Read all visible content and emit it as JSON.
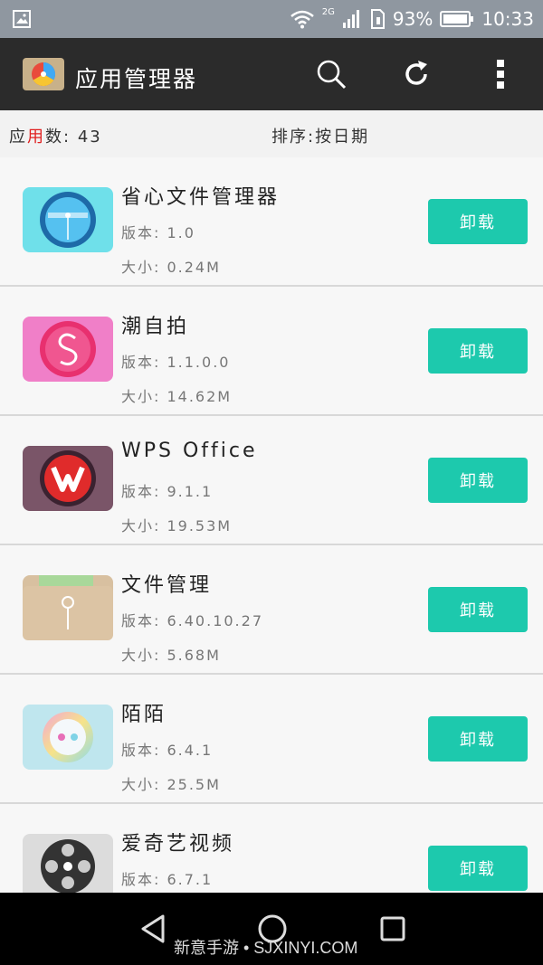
{
  "status_bar": {
    "network": "2G",
    "battery": "93%",
    "time": "10:33"
  },
  "app_bar": {
    "title": "应用管理器",
    "icons": [
      "app-logo-icon",
      "search-icon",
      "refresh-icon",
      "more-vert-icon"
    ]
  },
  "info": {
    "count_prefix_1": "应",
    "count_prefix_red": "用",
    "count_prefix_2": "数:",
    "count_value": "43",
    "sort_label": "排序:",
    "sort_value": "按日期"
  },
  "apps": [
    {
      "name": "省心文件管理器",
      "version": "版本: 1.0",
      "size": "大小: 0.24M",
      "button": "卸载"
    },
    {
      "name": "潮自拍",
      "version": "版本: 1.1.0.0",
      "size": "大小: 14.62M",
      "button": "卸载"
    },
    {
      "name": "WPS Office",
      "version": "版本: 9.1.1",
      "size": "大小: 19.53M",
      "button": "卸载"
    },
    {
      "name": "文件管理",
      "version": "版本: 6.40.10.27",
      "size": "大小: 5.68M",
      "button": "卸载"
    },
    {
      "name": "陌陌",
      "version": "版本: 6.4.1",
      "size": "大小: 25.5M",
      "button": "卸载"
    },
    {
      "name": "爱奇艺视频",
      "version": "版本: 6.7.1",
      "size": "",
      "button": "卸载"
    }
  ],
  "watermark": "新意手游 • SJXINYI.COM",
  "colors": {
    "accent": "#1dc9ad",
    "app_bar": "#2b2b2b",
    "status_bar": "#8f97a0",
    "highlight_red": "#e02020"
  }
}
